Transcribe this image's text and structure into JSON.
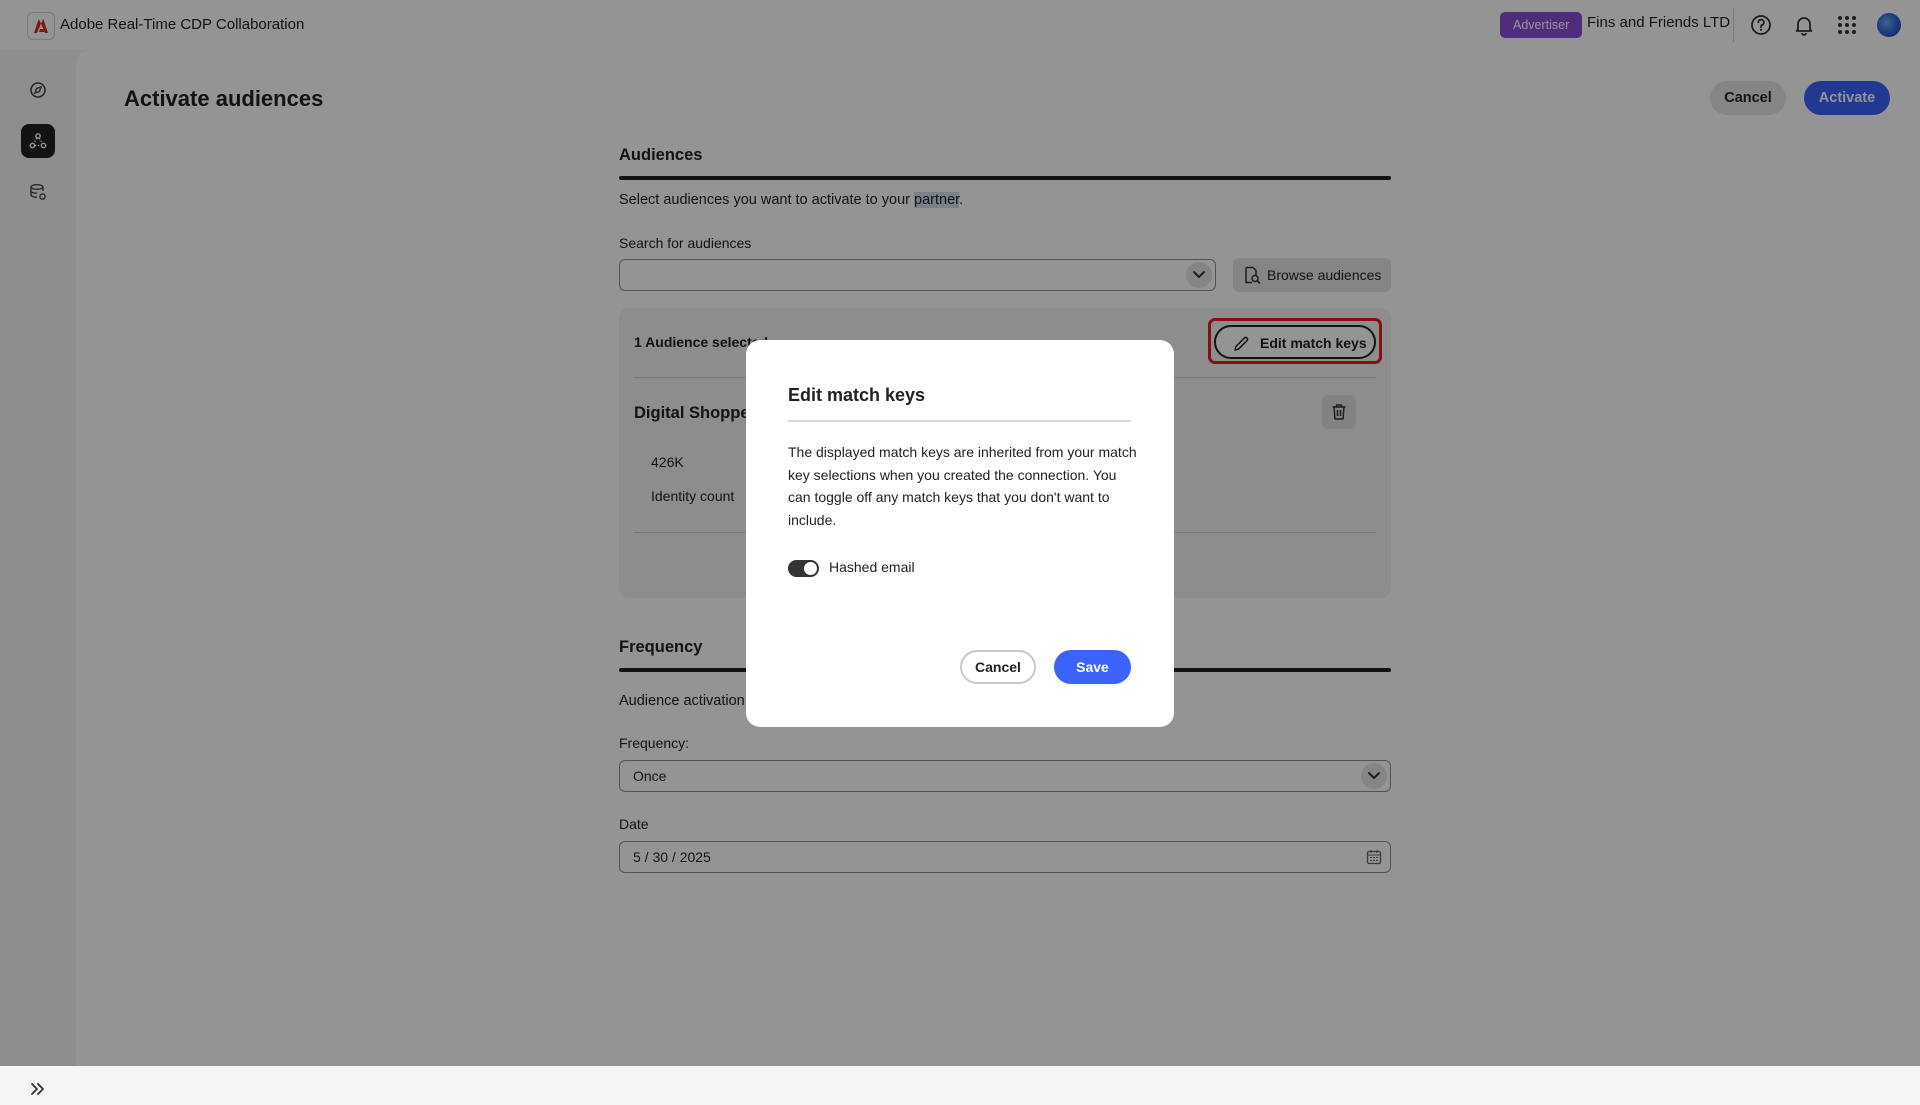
{
  "app": {
    "title": "Adobe Real-Time CDP Collaboration",
    "role_badge": "Advertiser",
    "org_name": "Fins and Friends LTD"
  },
  "icons": {
    "logo": "adobe-logo-icon",
    "help": "help-icon",
    "notifications": "bell-icon",
    "apps": "app-grid-icon",
    "avatar": "user-avatar"
  },
  "nav": {
    "items": [
      {
        "icon": "discover-icon",
        "active": false
      },
      {
        "icon": "connections-icon",
        "active": true
      },
      {
        "icon": "data-settings-icon",
        "active": false
      }
    ],
    "expand_icon": "chevron-double-right-icon"
  },
  "page": {
    "title": "Activate audiences",
    "cancel_label": "Cancel",
    "activate_label": "Activate"
  },
  "audiences": {
    "title": "Audiences",
    "description_prefix": "Select audiences you want to activate to your ",
    "description_highlight": "partner",
    "description_suffix": ".",
    "search_label": "Search for audiences",
    "search_value": "",
    "browse_label": "Browse audiences",
    "selected_count": "1 Audience selected",
    "edit_match_keys_label": "Edit match keys",
    "item": {
      "name": "Digital Shopper",
      "count_value": "426K",
      "count_label": "Identity count"
    }
  },
  "frequency": {
    "title": "Frequency",
    "description": "Audience activation w",
    "label": "Frequency:",
    "value": "Once",
    "date_label": "Date",
    "date_value": "5 / 30 / 2025"
  },
  "dialog": {
    "title": "Edit match keys",
    "body": "The displayed match keys are inherited from your match key selections when you created the connection. You can toggle off any match keys that you don't want to include.",
    "toggle_label": "Hashed email",
    "toggle_on": true,
    "cancel_label": "Cancel",
    "save_label": "Save"
  },
  "colors": {
    "accent": "#3b63fb",
    "badge": "#8a4fd6",
    "highlight_outline": "#e01e1e"
  }
}
